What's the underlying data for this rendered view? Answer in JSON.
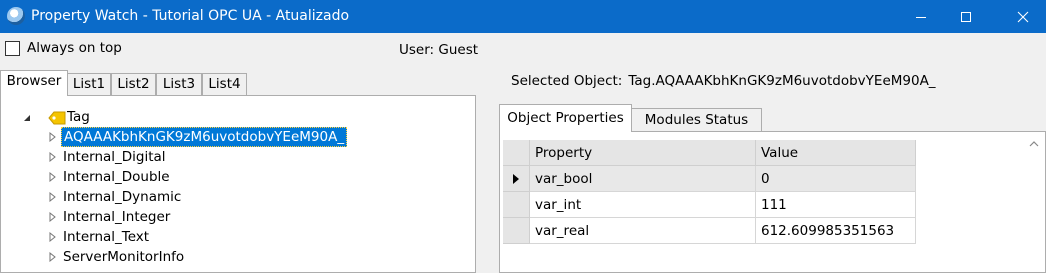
{
  "window": {
    "title": "Property Watch - Tutorial OPC UA - Atualizado",
    "accent_color": "#0b6bc9",
    "controls": [
      "minimize-icon",
      "maximize-icon",
      "close-icon"
    ]
  },
  "left": {
    "always_on_top_label": "Always on top",
    "always_on_top_checked": false,
    "user_label": "User: Guest",
    "tabs": [
      "Browser",
      "List1",
      "List2",
      "List3",
      "List4"
    ],
    "active_tab": "Browser",
    "tree": {
      "root": "Tag",
      "children": [
        "AQAAAKbhKnGK9zM6uvotdobvYEeM90A_",
        "Internal_Digital",
        "Internal_Double",
        "Internal_Dynamic",
        "Internal_Integer",
        "Internal_Text",
        "ServerMonitorInfo"
      ],
      "selected": "AQAAAKbhKnGK9zM6uvotdobvYEeM90A_"
    }
  },
  "right": {
    "selected_label": "Selected Object:",
    "selected_value": "Tag.AQAAAKbhKnGK9zM6uvotdobvYEeM90A_",
    "tabs": [
      "Object Properties",
      "Modules Status"
    ],
    "active_tab": "Object Properties",
    "grid": {
      "columns": [
        "Property",
        "Value"
      ],
      "rows": [
        {
          "property": "var_bool",
          "value": "0"
        },
        {
          "property": "var_int",
          "value": "111"
        },
        {
          "property": "var_real",
          "value": "612.609985351563"
        }
      ]
    }
  }
}
